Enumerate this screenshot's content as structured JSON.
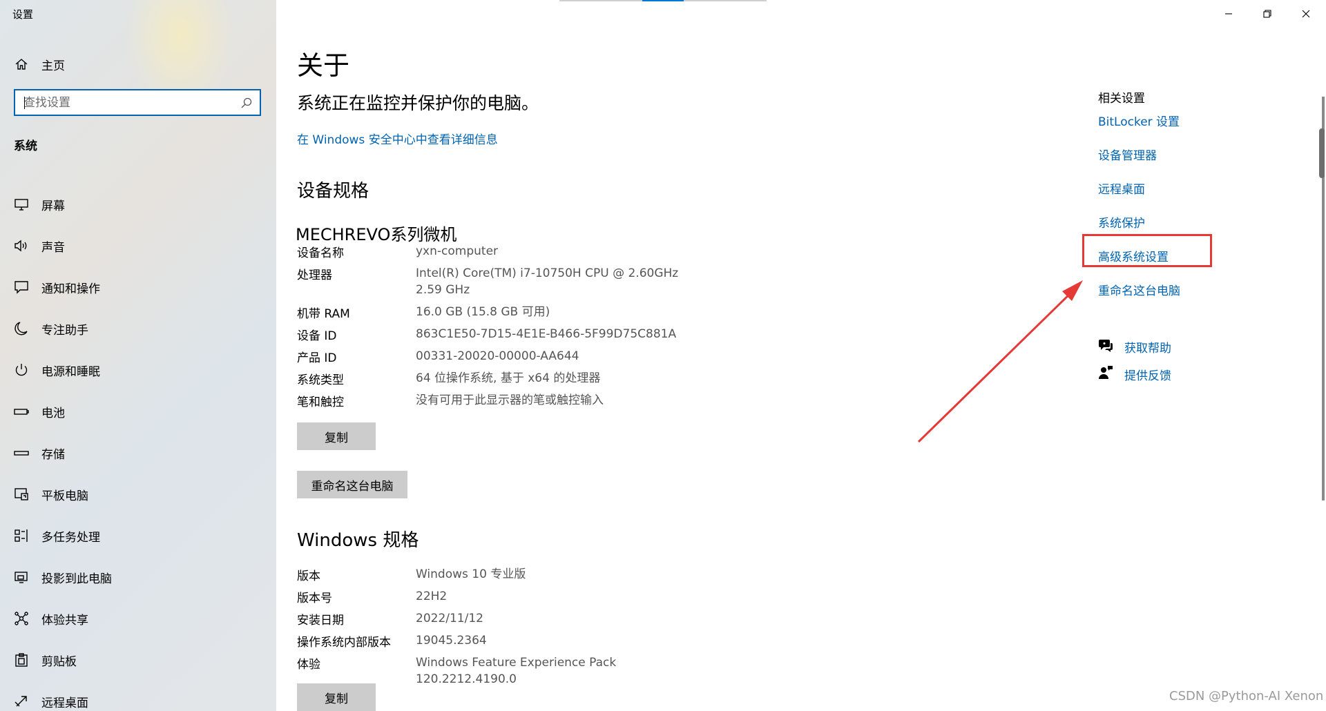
{
  "window": {
    "title": "设置"
  },
  "sidebar": {
    "home": {
      "label": "主页",
      "icon": "home-icon"
    },
    "search": {
      "placeholder": "查找设置",
      "value": ""
    },
    "section_title": "系统",
    "items": [
      {
        "label": "屏幕",
        "icon": "display-icon"
      },
      {
        "label": "声音",
        "icon": "speaker-icon"
      },
      {
        "label": "通知和操作",
        "icon": "notification-icon"
      },
      {
        "label": "专注助手",
        "icon": "moon-icon"
      },
      {
        "label": "电源和睡眠",
        "icon": "power-icon"
      },
      {
        "label": "电池",
        "icon": "battery-icon"
      },
      {
        "label": "存储",
        "icon": "storage-icon"
      },
      {
        "label": "平板电脑",
        "icon": "tablet-icon"
      },
      {
        "label": "多任务处理",
        "icon": "multitask-icon"
      },
      {
        "label": "投影到此电脑",
        "icon": "project-icon"
      },
      {
        "label": "体验共享",
        "icon": "share-icon"
      },
      {
        "label": "剪贴板",
        "icon": "clipboard-icon"
      },
      {
        "label": "远程桌面",
        "icon": "remote-desktop-icon"
      }
    ]
  },
  "main": {
    "title": "关于",
    "security_text": "系统正在监控并保护你的电脑。",
    "security_link": "在 Windows 安全中心中查看详细信息",
    "device_specs": {
      "heading": "设备规格",
      "model": "MECHREVO系列微机",
      "rows": [
        {
          "label": "设备名称",
          "value": "yxn-computer"
        },
        {
          "label": "处理器",
          "value": "Intel(R) Core(TM) i7-10750H CPU @ 2.60GHz   2.59 GHz"
        },
        {
          "label": "机带 RAM",
          "value": "16.0 GB (15.8 GB 可用)"
        },
        {
          "label": "设备 ID",
          "value": "863C1E50-7D15-4E1E-B466-5F99D75C881A"
        },
        {
          "label": "产品 ID",
          "value": "00331-20020-00000-AA644"
        },
        {
          "label": "系统类型",
          "value": "64 位操作系统, 基于 x64 的处理器"
        },
        {
          "label": "笔和触控",
          "value": "没有可用于此显示器的笔或触控输入"
        }
      ],
      "copy_label": "复制",
      "rename_label": "重命名这台电脑"
    },
    "windows_specs": {
      "heading": "Windows 规格",
      "rows": [
        {
          "label": "版本",
          "value": "Windows 10 专业版"
        },
        {
          "label": "版本号",
          "value": "22H2"
        },
        {
          "label": "安装日期",
          "value": "2022/11/12"
        },
        {
          "label": "操作系统内部版本",
          "value": "19045.2364"
        },
        {
          "label": "体验",
          "value": "Windows Feature Experience Pack 120.2212.4190.0"
        }
      ],
      "copy_label": "复制"
    }
  },
  "related": {
    "title": "相关设置",
    "links": [
      "BitLocker 设置",
      "设备管理器",
      "远程桌面",
      "系统保护",
      "高级系统设置",
      "重命名这台电脑"
    ],
    "help": {
      "label": "获取帮助",
      "icon": "help-chat-icon"
    },
    "feedback": {
      "label": "提供反馈",
      "icon": "feedback-icon"
    }
  },
  "annotation": {
    "color": "#e53935",
    "target": "高级系统设置"
  },
  "watermark": "CSDN @Python-AI Xenon",
  "colors": {
    "accent": "#0063b1",
    "button": "#cccccc",
    "annotation": "#e53935"
  }
}
